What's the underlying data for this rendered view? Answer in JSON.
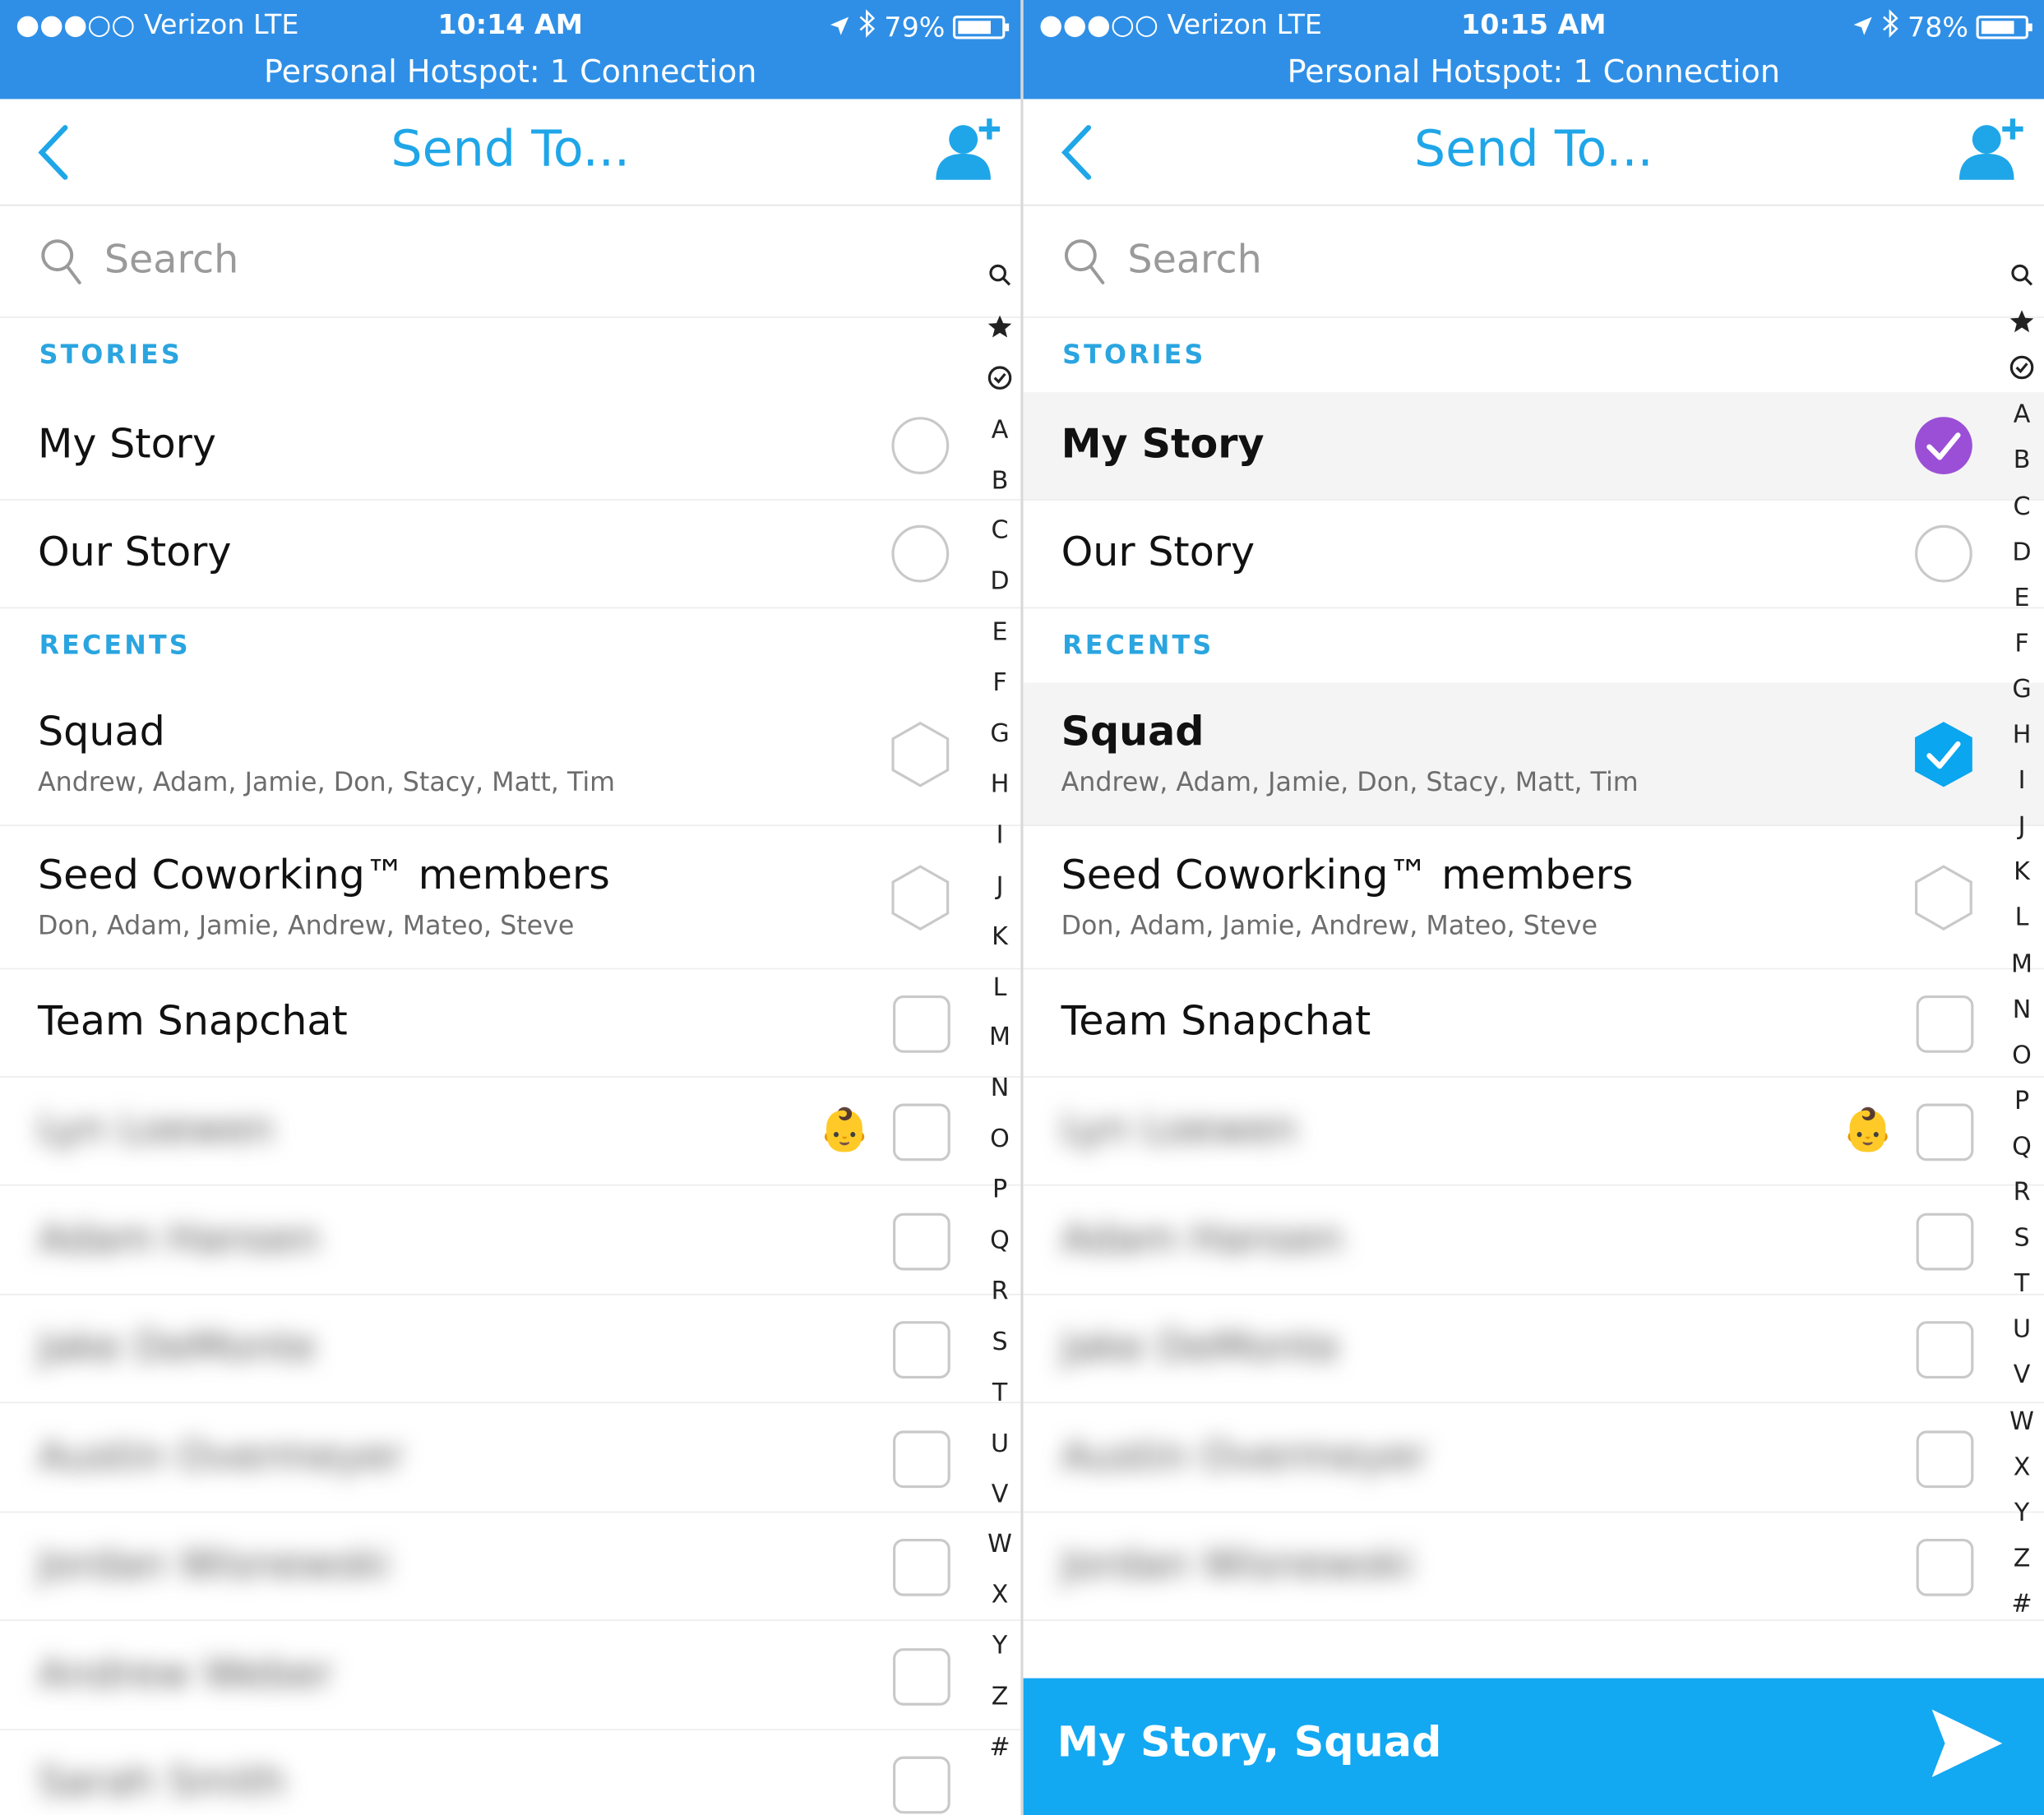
{
  "screens": [
    {
      "status": {
        "carrier": "●●●○○ Verizon  LTE",
        "time": "10:14 AM",
        "battery": "79%",
        "battery_level": 0.79,
        "hotspot": "Personal Hotspot: 1 Connection"
      },
      "nav": {
        "title": "Send To..."
      },
      "search": {
        "placeholder": "Search"
      },
      "sections": {
        "stories": "STORIES",
        "recents": "RECENTS"
      },
      "stories": [
        {
          "name": "My Story",
          "selected": false,
          "control": "circle"
        },
        {
          "name": "Our Story",
          "selected": false,
          "control": "circle"
        }
      ],
      "groups": [
        {
          "name": "Squad",
          "members": "Andrew, Adam, Jamie, Don, Stacy, Matt, Tim",
          "selected": false,
          "control": "hexagon"
        },
        {
          "name": "Seed Coworking™ members",
          "members": "Don, Adam, Jamie, Andrew, Mateo, Steve",
          "selected": false,
          "control": "hexagon"
        }
      ],
      "team": {
        "name": "Team Snapchat",
        "control": "square"
      },
      "friends": [
        {
          "name": "Lyn Loewen",
          "emoji": "👶"
        },
        {
          "name": "Adam Hansen"
        },
        {
          "name": "Jake DeMonte"
        },
        {
          "name": "Austin Overmeyer"
        },
        {
          "name": "Jordan Wisnewski"
        },
        {
          "name": "Andrew Weber"
        },
        {
          "name": "Sarah Smith"
        }
      ],
      "index": [
        "search",
        "star",
        "clock",
        "A",
        "B",
        "C",
        "D",
        "E",
        "F",
        "G",
        "H",
        "I",
        "J",
        "K",
        "L",
        "M",
        "N",
        "O",
        "P",
        "Q",
        "R",
        "S",
        "T",
        "U",
        "V",
        "W",
        "X",
        "Y",
        "Z",
        "#"
      ]
    },
    {
      "status": {
        "carrier": "●●●○○ Verizon  LTE",
        "time": "10:15 AM",
        "battery": "78%",
        "battery_level": 0.78,
        "hotspot": "Personal Hotspot: 1 Connection"
      },
      "nav": {
        "title": "Send To..."
      },
      "search": {
        "placeholder": "Search"
      },
      "sections": {
        "stories": "STORIES",
        "recents": "RECENTS"
      },
      "stories": [
        {
          "name": "My Story",
          "selected": true,
          "control": "circle"
        },
        {
          "name": "Our Story",
          "selected": false,
          "control": "circle"
        }
      ],
      "groups": [
        {
          "name": "Squad",
          "members": "Andrew, Adam, Jamie, Don, Stacy, Matt, Tim",
          "selected": true,
          "control": "hexagon"
        },
        {
          "name": "Seed Coworking™ members",
          "members": "Don, Adam, Jamie, Andrew, Mateo, Steve",
          "selected": false,
          "control": "hexagon"
        }
      ],
      "team": {
        "name": "Team Snapchat",
        "control": "square"
      },
      "friends": [
        {
          "name": "Lyn Loewen",
          "emoji": "👶"
        },
        {
          "name": "Adam Hansen"
        },
        {
          "name": "Jake DeMonte"
        },
        {
          "name": "Austin Overmeyer"
        },
        {
          "name": "Jordan Wisnewski"
        }
      ],
      "index": [
        "search",
        "star",
        "clock",
        "A",
        "B",
        "C",
        "D",
        "E",
        "F",
        "G",
        "H",
        "I",
        "J",
        "K",
        "L",
        "M",
        "N",
        "O",
        "P",
        "Q",
        "R",
        "S",
        "T",
        "U",
        "V",
        "W",
        "X",
        "Y",
        "Z",
        "#"
      ],
      "send_bar": {
        "label": "My Story, Squad"
      }
    }
  ],
  "colors": {
    "status_bar": "#2f8fe6",
    "accent_blue": "#1fa6e8",
    "story_selected": "#9b4fd6",
    "group_selected": "#0aa6ef",
    "send_bar": "#13a8f2"
  }
}
